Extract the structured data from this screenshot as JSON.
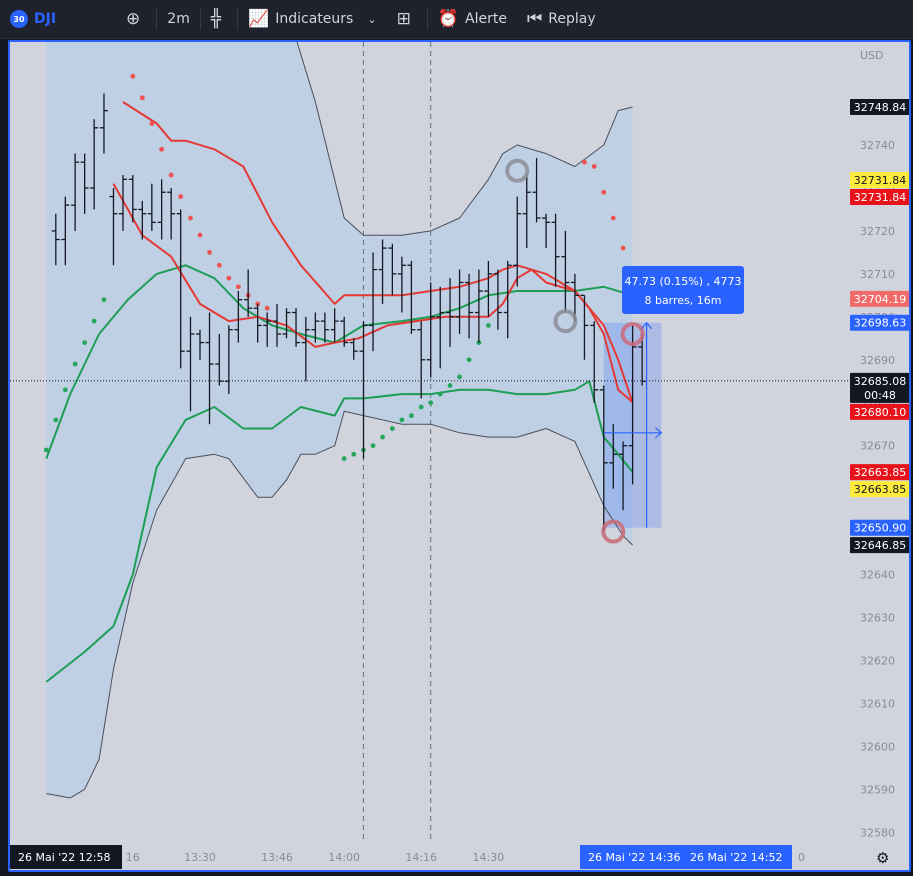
{
  "toolbar": {
    "badge": "30",
    "symbol": "DJI",
    "interval": "2m",
    "indicators_label": "Indicateurs",
    "alert_label": "Alerte",
    "replay_label": "Replay"
  },
  "colors": {
    "background": "#d1d4dc",
    "bb_fill": "#bccfe6",
    "upper_band": "#e53935",
    "lower_band": "#1e9e55",
    "outer_band": "#4a4e5a",
    "sar_red": "#ef5350",
    "sar_green": "#26a65b",
    "accent": "#2962ff",
    "price_tag": "#131722",
    "red_tag": "#e8121b",
    "yellow_tag": "#ffeb3b"
  },
  "chart_data": {
    "type": "candlestick",
    "currency": "USD",
    "y_ticks": [
      32580,
      32590,
      32600,
      32610,
      32620,
      32630,
      32640,
      32650,
      32660,
      32670,
      32680,
      32690,
      32700,
      32710,
      32720,
      32730,
      32740
    ],
    "x_ticks": [
      "16",
      "13:30",
      "13:46",
      "14:00",
      "14:16",
      "14:30"
    ],
    "x_tick_times": [
      13.267,
      13.5,
      13.767,
      14.0,
      14.267,
      14.5
    ],
    "vertical_dashed_times": [
      14.0667,
      14.3
    ],
    "price_labels": [
      {
        "text": "32748.84",
        "value": 32748.84,
        "style": "dark"
      },
      {
        "text": "32731.84",
        "value": 32731.84,
        "style": "yellow"
      },
      {
        "text": "32731.84",
        "value": 32731.84,
        "style": "red"
      },
      {
        "text": "32704.19",
        "value": 32704.19,
        "style": "lightred"
      },
      {
        "text": "32698.63",
        "value": 32698.63,
        "style": "blue"
      },
      {
        "text": "32685.08",
        "value": 32685.08,
        "style": "dark",
        "sub": "00:48"
      },
      {
        "text": "32680.10",
        "value": 32680.1,
        "style": "red"
      },
      {
        "text": "32663.85",
        "value": 32663.85,
        "style": "red"
      },
      {
        "text": "32663.85",
        "value": 32663.85,
        "style": "yellow"
      },
      {
        "text": "32650.90",
        "value": 32650.9,
        "style": "blue"
      },
      {
        "text": "32646.85",
        "value": 32646.85,
        "style": "dark"
      }
    ],
    "last_price": 32685.08,
    "countdown": "00:48",
    "bars": [
      {
        "t": 13.0,
        "o": 32720,
        "h": 32724,
        "l": 32712,
        "c": 32718
      },
      {
        "t": 13.033,
        "o": 32718,
        "h": 32728,
        "l": 32712,
        "c": 32726
      },
      {
        "t": 13.067,
        "o": 32726,
        "h": 32738,
        "l": 32720,
        "c": 32736
      },
      {
        "t": 13.1,
        "o": 32736,
        "h": 32738,
        "l": 32724,
        "c": 32730
      },
      {
        "t": 13.133,
        "o": 32730,
        "h": 32746,
        "l": 32725,
        "c": 32744
      },
      {
        "t": 13.167,
        "o": 32744,
        "h": 32752,
        "l": 32738,
        "c": 32748
      },
      {
        "t": 13.2,
        "o": 32728,
        "h": 32730,
        "l": 32712,
        "c": 32724
      },
      {
        "t": 13.233,
        "o": 32724,
        "h": 32733,
        "l": 32720,
        "c": 32732
      },
      {
        "t": 13.267,
        "o": 32732,
        "h": 32733,
        "l": 32722,
        "c": 32725
      },
      {
        "t": 13.3,
        "o": 32725,
        "h": 32727,
        "l": 32718,
        "c": 32724
      },
      {
        "t": 13.333,
        "o": 32724,
        "h": 32731,
        "l": 32720,
        "c": 32722
      },
      {
        "t": 13.367,
        "o": 32722,
        "h": 32732,
        "l": 32718,
        "c": 32729
      },
      {
        "t": 13.4,
        "o": 32729,
        "h": 32730,
        "l": 32718,
        "c": 32724
      },
      {
        "t": 13.433,
        "o": 32724,
        "h": 32725,
        "l": 32688,
        "c": 32692
      },
      {
        "t": 13.467,
        "o": 32692,
        "h": 32700,
        "l": 32678,
        "c": 32696
      },
      {
        "t": 13.5,
        "o": 32696,
        "h": 32697,
        "l": 32690,
        "c": 32694
      },
      {
        "t": 13.533,
        "o": 32694,
        "h": 32701,
        "l": 32675,
        "c": 32689
      },
      {
        "t": 13.567,
        "o": 32689,
        "h": 32696,
        "l": 32684,
        "c": 32685
      },
      {
        "t": 13.6,
        "o": 32685,
        "h": 32698,
        "l": 32682,
        "c": 32697
      },
      {
        "t": 13.633,
        "o": 32697,
        "h": 32706,
        "l": 32694,
        "c": 32704
      },
      {
        "t": 13.667,
        "o": 32704,
        "h": 32711,
        "l": 32700,
        "c": 32702
      },
      {
        "t": 13.7,
        "o": 32702,
        "h": 32703,
        "l": 32694,
        "c": 32698
      },
      {
        "t": 13.733,
        "o": 32698,
        "h": 32701,
        "l": 32693,
        "c": 32699
      },
      {
        "t": 13.767,
        "o": 32699,
        "h": 32703,
        "l": 32693,
        "c": 32696
      },
      {
        "t": 13.8,
        "o": 32696,
        "h": 32702,
        "l": 32695,
        "c": 32701
      },
      {
        "t": 13.833,
        "o": 32701,
        "h": 32702,
        "l": 32693,
        "c": 32694
      },
      {
        "t": 13.867,
        "o": 32694,
        "h": 32700,
        "l": 32685,
        "c": 32697
      },
      {
        "t": 13.9,
        "o": 32697,
        "h": 32701,
        "l": 32694,
        "c": 32699
      },
      {
        "t": 13.933,
        "o": 32699,
        "h": 32701,
        "l": 32694,
        "c": 32697
      },
      {
        "t": 13.967,
        "o": 32697,
        "h": 32702,
        "l": 32694,
        "c": 32699
      },
      {
        "t": 14.0,
        "o": 32699,
        "h": 32700,
        "l": 32693,
        "c": 32694
      },
      {
        "t": 14.033,
        "o": 32694,
        "h": 32695,
        "l": 32690,
        "c": 32692
      },
      {
        "t": 14.067,
        "o": 32692,
        "h": 32699,
        "l": 32667,
        "c": 32698
      },
      {
        "t": 14.1,
        "o": 32698,
        "h": 32715,
        "l": 32692,
        "c": 32711
      },
      {
        "t": 14.133,
        "o": 32711,
        "h": 32718,
        "l": 32703,
        "c": 32716
      },
      {
        "t": 14.167,
        "o": 32716,
        "h": 32717,
        "l": 32705,
        "c": 32710
      },
      {
        "t": 14.2,
        "o": 32710,
        "h": 32714,
        "l": 32701,
        "c": 32712
      },
      {
        "t": 14.233,
        "o": 32712,
        "h": 32713,
        "l": 32696,
        "c": 32697
      },
      {
        "t": 14.267,
        "o": 32697,
        "h": 32699,
        "l": 32681,
        "c": 32690
      },
      {
        "t": 14.3,
        "o": 32690,
        "h": 32708,
        "l": 32686,
        "c": 32700
      },
      {
        "t": 14.333,
        "o": 32700,
        "h": 32707,
        "l": 32688,
        "c": 32701
      },
      {
        "t": 14.367,
        "o": 32701,
        "h": 32709,
        "l": 32693,
        "c": 32700
      },
      {
        "t": 14.4,
        "o": 32700,
        "h": 32711,
        "l": 32696,
        "c": 32708
      },
      {
        "t": 14.433,
        "o": 32708,
        "h": 32710,
        "l": 32695,
        "c": 32701
      },
      {
        "t": 14.467,
        "o": 32701,
        "h": 32711,
        "l": 32694,
        "c": 32706
      },
      {
        "t": 14.5,
        "o": 32706,
        "h": 32713,
        "l": 32700,
        "c": 32710
      },
      {
        "t": 14.533,
        "o": 32710,
        "h": 32711,
        "l": 32697,
        "c": 32701
      },
      {
        "t": 14.567,
        "o": 32701,
        "h": 32713,
        "l": 32695,
        "c": 32712
      },
      {
        "t": 14.6,
        "o": 32712,
        "h": 32728,
        "l": 32707,
        "c": 32724
      },
      {
        "t": 14.633,
        "o": 32724,
        "h": 32733,
        "l": 32716,
        "c": 32729
      },
      {
        "t": 14.667,
        "o": 32729,
        "h": 32737,
        "l": 32722,
        "c": 32723
      },
      {
        "t": 14.7,
        "o": 32723,
        "h": 32724,
        "l": 32716,
        "c": 32722
      },
      {
        "t": 14.733,
        "o": 32722,
        "h": 32724,
        "l": 32707,
        "c": 32714
      },
      {
        "t": 14.767,
        "o": 32714,
        "h": 32720,
        "l": 32701,
        "c": 32708
      },
      {
        "t": 14.8,
        "o": 32708,
        "h": 32710,
        "l": 32699,
        "c": 32705
      },
      {
        "t": 14.833,
        "o": 32705,
        "h": 32705,
        "l": 32690,
        "c": 32698
      },
      {
        "t": 14.867,
        "o": 32698,
        "h": 32699,
        "l": 32680,
        "c": 32683
      },
      {
        "t": 14.9,
        "o": 32683,
        "h": 32684,
        "l": 32650,
        "c": 32666
      },
      {
        "t": 14.933,
        "o": 32666,
        "h": 32675,
        "l": 32660,
        "c": 32668
      },
      {
        "t": 14.967,
        "o": 32668,
        "h": 32671,
        "l": 32655,
        "c": 32670
      },
      {
        "t": 15.0,
        "o": 32670,
        "h": 32698,
        "l": 32661,
        "c": 32693
      },
      {
        "t": 15.033,
        "o": 32693,
        "h": 32696,
        "l": 32684,
        "c": 32685
      }
    ],
    "bb_upper_outer": [
      [
        12.967,
        32790
      ],
      [
        13.05,
        32775
      ],
      [
        13.15,
        32780
      ],
      [
        13.3,
        32786
      ],
      [
        13.4,
        32785
      ],
      [
        13.5,
        32790
      ],
      [
        13.6,
        32798
      ],
      [
        13.7,
        32790
      ],
      [
        13.8,
        32772
      ],
      [
        13.9,
        32750
      ],
      [
        14.0,
        32723
      ],
      [
        14.067,
        32719
      ],
      [
        14.2,
        32719
      ],
      [
        14.3,
        32720
      ],
      [
        14.4,
        32723
      ],
      [
        14.5,
        32732
      ],
      [
        14.55,
        32738
      ],
      [
        14.6,
        32740
      ],
      [
        14.7,
        32738
      ],
      [
        14.8,
        32735
      ],
      [
        14.9,
        32740
      ],
      [
        14.95,
        32748
      ],
      [
        15.0,
        32748.84
      ]
    ],
    "bb_lower_outer": [
      [
        12.967,
        32589
      ],
      [
        13.05,
        32588
      ],
      [
        13.1,
        32590
      ],
      [
        13.15,
        32597
      ],
      [
        13.2,
        32618
      ],
      [
        13.267,
        32638
      ],
      [
        13.35,
        32655
      ],
      [
        13.45,
        32667
      ],
      [
        13.55,
        32668
      ],
      [
        13.6,
        32667
      ],
      [
        13.7,
        32658
      ],
      [
        13.75,
        32658
      ],
      [
        13.8,
        32662
      ],
      [
        13.85,
        32668
      ],
      [
        13.9,
        32668
      ],
      [
        13.967,
        32670
      ],
      [
        14.0,
        32678
      ],
      [
        14.067,
        32677
      ],
      [
        14.2,
        32675
      ],
      [
        14.3,
        32675
      ],
      [
        14.4,
        32673
      ],
      [
        14.5,
        32672
      ],
      [
        14.6,
        32672
      ],
      [
        14.7,
        32674
      ],
      [
        14.8,
        32671
      ],
      [
        14.9,
        32656
      ],
      [
        14.967,
        32649
      ],
      [
        15.0,
        32646.85
      ]
    ],
    "bb_upper_inner": [
      [
        13.233,
        32750
      ],
      [
        13.35,
        32745
      ],
      [
        13.4,
        32741
      ],
      [
        13.45,
        32741
      ],
      [
        13.55,
        32739
      ],
      [
        13.65,
        32735
      ],
      [
        13.75,
        32722
      ],
      [
        13.85,
        32712
      ],
      [
        13.967,
        32703
      ],
      [
        14.0,
        32705
      ],
      [
        14.1,
        32705
      ],
      [
        14.2,
        32705
      ],
      [
        14.3,
        32706
      ],
      [
        14.4,
        32707
      ],
      [
        14.5,
        32709
      ],
      [
        14.55,
        32711
      ],
      [
        14.6,
        32712
      ],
      [
        14.7,
        32710
      ],
      [
        14.8,
        32706
      ],
      [
        14.85,
        32702
      ],
      [
        14.9,
        32696
      ],
      [
        14.95,
        32683
      ],
      [
        15.0,
        32680.1
      ]
    ],
    "bb_lower_inner": [
      [
        12.967,
        32615
      ],
      [
        13.1,
        32622
      ],
      [
        13.2,
        32628
      ],
      [
        13.267,
        32640
      ],
      [
        13.35,
        32665
      ],
      [
        13.45,
        32676
      ],
      [
        13.55,
        32679
      ],
      [
        13.65,
        32674
      ],
      [
        13.75,
        32674
      ],
      [
        13.85,
        32679
      ],
      [
        13.967,
        32677
      ],
      [
        14.0,
        32681
      ],
      [
        14.067,
        32681
      ],
      [
        14.2,
        32682
      ],
      [
        14.3,
        32682
      ],
      [
        14.4,
        32683
      ],
      [
        14.5,
        32683
      ],
      [
        14.6,
        32682
      ],
      [
        14.7,
        32682
      ],
      [
        14.8,
        32683
      ],
      [
        14.85,
        32685
      ],
      [
        14.9,
        32672
      ],
      [
        14.95,
        32668
      ],
      [
        15.0,
        32663.85
      ]
    ],
    "mid_red": [
      [
        13.2,
        32731
      ],
      [
        13.3,
        32719
      ],
      [
        13.4,
        32714
      ],
      [
        13.5,
        32703
      ],
      [
        13.6,
        32699
      ],
      [
        13.7,
        32700
      ],
      [
        13.8,
        32698
      ],
      [
        13.9,
        32693
      ],
      [
        13.967,
        32694
      ],
      [
        14.05,
        32695
      ],
      [
        14.15,
        32698
      ],
      [
        14.25,
        32699
      ],
      [
        14.35,
        32700
      ],
      [
        14.45,
        32700
      ],
      [
        14.5,
        32700
      ],
      [
        14.55,
        32703
      ],
      [
        14.6,
        32709
      ],
      [
        14.65,
        32711
      ],
      [
        14.7,
        32708
      ],
      [
        14.8,
        32706
      ],
      [
        14.9,
        32698
      ],
      [
        14.95,
        32690
      ],
      [
        15.0,
        32680
      ]
    ],
    "mid_green": [
      [
        12.967,
        32667
      ],
      [
        13.05,
        32682
      ],
      [
        13.15,
        32696
      ],
      [
        13.25,
        32704
      ],
      [
        13.35,
        32710
      ],
      [
        13.45,
        32712
      ],
      [
        13.55,
        32709
      ],
      [
        13.65,
        32702
      ],
      [
        13.75,
        32698
      ],
      [
        13.85,
        32696
      ],
      [
        13.967,
        32694
      ],
      [
        14.067,
        32698
      ],
      [
        14.2,
        32699
      ],
      [
        14.3,
        32700
      ],
      [
        14.4,
        32702
      ],
      [
        14.5,
        32705
      ],
      [
        14.6,
        32706
      ],
      [
        14.7,
        32706
      ],
      [
        14.8,
        32706
      ],
      [
        14.9,
        32707
      ],
      [
        15.0,
        32705
      ]
    ],
    "sar_red": [
      [
        13.267,
        32756
      ],
      [
        13.3,
        32751
      ],
      [
        13.333,
        32745
      ],
      [
        13.367,
        32739
      ],
      [
        13.4,
        32733
      ],
      [
        13.433,
        32728
      ],
      [
        13.467,
        32723
      ],
      [
        13.5,
        32719
      ],
      [
        13.533,
        32715
      ],
      [
        13.567,
        32712
      ],
      [
        13.6,
        32709
      ],
      [
        13.633,
        32707
      ],
      [
        13.667,
        32705
      ],
      [
        13.7,
        32703
      ],
      [
        13.733,
        32702
      ],
      [
        14.833,
        32736
      ],
      [
        14.867,
        32735
      ],
      [
        14.9,
        32729
      ],
      [
        14.933,
        32723
      ],
      [
        14.967,
        32716
      ],
      [
        15.0,
        32711
      ]
    ],
    "sar_green": [
      [
        12.967,
        32669
      ],
      [
        13.0,
        32676
      ],
      [
        13.033,
        32683
      ],
      [
        13.067,
        32689
      ],
      [
        13.1,
        32694
      ],
      [
        13.133,
        32699
      ],
      [
        13.167,
        32704
      ],
      [
        14.0,
        32667
      ],
      [
        14.033,
        32668
      ],
      [
        14.067,
        32669
      ],
      [
        14.1,
        32670
      ],
      [
        14.133,
        32672
      ],
      [
        14.167,
        32674
      ],
      [
        14.2,
        32676
      ],
      [
        14.233,
        32677
      ],
      [
        14.267,
        32679
      ],
      [
        14.3,
        32680
      ],
      [
        14.333,
        32682
      ],
      [
        14.367,
        32684
      ],
      [
        14.4,
        32686
      ],
      [
        14.433,
        32690
      ],
      [
        14.467,
        32694
      ],
      [
        14.5,
        32698
      ]
    ],
    "circles": [
      {
        "t": 14.6,
        "v": 32734,
        "color": "#8a8d96"
      },
      {
        "t": 14.767,
        "v": 32699,
        "color": "#8a8d96"
      },
      {
        "t": 14.933,
        "v": 32650,
        "color": "#c96a78"
      },
      {
        "t": 15.0,
        "v": 32696,
        "color": "#c96a78"
      }
    ],
    "measure": {
      "t0": 14.9,
      "t1": 15.1,
      "v0": 32650.9,
      "v1": 32698.63,
      "label_line1": "47.73 (0.15%) , 4773",
      "label_line2": "8 barres, 16m"
    },
    "bottom_labels": {
      "left_date": "26 Mai '22",
      "left_time": "12:58",
      "sel_date1": "26 Mai '22",
      "sel_time1": "14:36",
      "sel_date2": "26 Mai '22",
      "sel_time2": "14:52",
      "right_partial": "0"
    }
  }
}
